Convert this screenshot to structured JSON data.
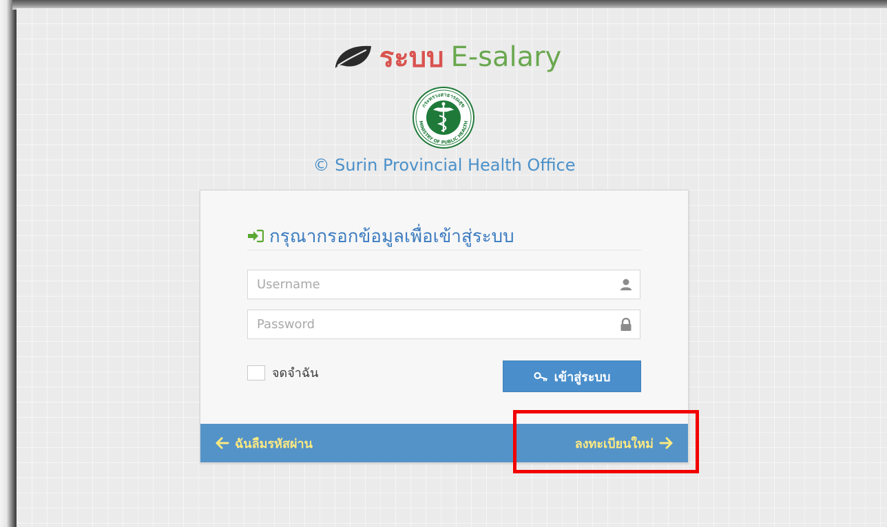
{
  "brand": {
    "thai_word": "ระบบ",
    "english_word": "E-salary",
    "icon": "leaf-icon"
  },
  "seal": {
    "icon": "ministry-seal-icon",
    "text_top": "กระทรวงสาธารณสุข",
    "text_bottom": "MINISTRY OF PUBLIC HEALTH"
  },
  "organization": "© Surin Provincial Health Office",
  "login": {
    "title": "กรุณากรอกข้อมูลเพื่อเข้าสู่ระบบ",
    "title_icon": "sign-in-icon",
    "username_placeholder": "Username",
    "username_icon": "user-icon",
    "password_placeholder": "Password",
    "password_icon": "lock-icon",
    "remember_label": "จดจำฉัน",
    "submit_label": "เข้าสู่ระบบ",
    "submit_icon": "key-icon"
  },
  "footer": {
    "forgot_label": "ฉันลืมรหัสผ่าน",
    "register_label": "ลงทะเบียนใหม่"
  },
  "colors": {
    "brand_red": "#d9534f",
    "brand_green": "#6aa84f",
    "primary_blue": "#4a8fcc",
    "footer_blue": "#5493c8",
    "link_yellow": "#fbe981",
    "highlight_red": "#f20000"
  }
}
